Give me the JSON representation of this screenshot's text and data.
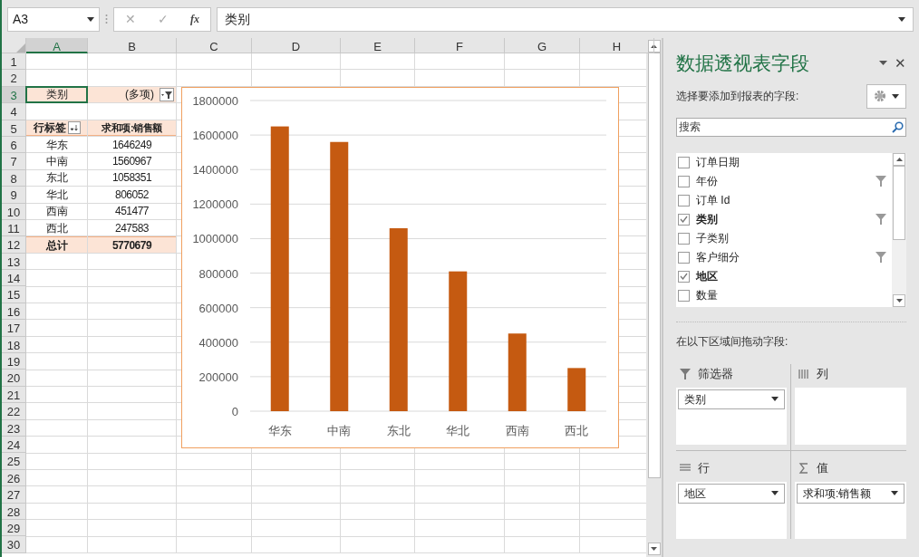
{
  "formula_bar": {
    "name_box": "A3",
    "cancel": "✕",
    "enter": "✓",
    "function": "fx",
    "value": "类别"
  },
  "sheet": {
    "columns": [
      {
        "label": "A",
        "selected": true
      },
      {
        "label": "B",
        "selected": false
      },
      {
        "label": "C",
        "selected": false
      },
      {
        "label": "D",
        "selected": false
      },
      {
        "label": "E",
        "selected": false
      },
      {
        "label": "F",
        "selected": false
      },
      {
        "label": "G",
        "selected": false
      },
      {
        "label": "H",
        "selected": false
      }
    ],
    "rows": [
      {
        "header": "1",
        "kind": "empty",
        "selected": false
      },
      {
        "header": "2",
        "kind": "empty",
        "selected": false
      },
      {
        "header": "3",
        "kind": "filter",
        "selected": true,
        "a": "类别",
        "b": "(多项)"
      },
      {
        "header": "4",
        "kind": "empty",
        "selected": false
      },
      {
        "header": "5",
        "kind": "header",
        "selected": false,
        "a": "行标签",
        "b": "求和项:销售额"
      },
      {
        "header": "6",
        "kind": "data",
        "selected": false,
        "a": "华东",
        "b": "1646249"
      },
      {
        "header": "7",
        "kind": "data",
        "selected": false,
        "a": "中南",
        "b": "1560967"
      },
      {
        "header": "8",
        "kind": "data",
        "selected": false,
        "a": "东北",
        "b": "1058351"
      },
      {
        "header": "9",
        "kind": "data",
        "selected": false,
        "a": "华北",
        "b": "806052"
      },
      {
        "header": "10",
        "kind": "data",
        "selected": false,
        "a": "西南",
        "b": "451477"
      },
      {
        "header": "11",
        "kind": "data",
        "selected": false,
        "a": "西北",
        "b": "247583"
      },
      {
        "header": "12",
        "kind": "total",
        "selected": false,
        "a": "总计",
        "b": "5770679"
      },
      {
        "header": "13",
        "kind": "empty",
        "selected": false
      },
      {
        "header": "14",
        "kind": "empty",
        "selected": false
      },
      {
        "header": "15",
        "kind": "empty",
        "selected": false
      },
      {
        "header": "16",
        "kind": "empty",
        "selected": false
      },
      {
        "header": "17",
        "kind": "empty",
        "selected": false
      },
      {
        "header": "18",
        "kind": "empty",
        "selected": false
      },
      {
        "header": "19",
        "kind": "empty",
        "selected": false
      },
      {
        "header": "20",
        "kind": "empty",
        "selected": false
      },
      {
        "header": "21",
        "kind": "empty",
        "selected": false
      },
      {
        "header": "22",
        "kind": "empty",
        "selected": false
      },
      {
        "header": "23",
        "kind": "empty",
        "selected": false
      },
      {
        "header": "24",
        "kind": "empty",
        "selected": false
      },
      {
        "header": "25",
        "kind": "empty",
        "selected": false
      },
      {
        "header": "26",
        "kind": "empty",
        "selected": false
      },
      {
        "header": "27",
        "kind": "empty",
        "selected": false
      },
      {
        "header": "28",
        "kind": "empty",
        "selected": false
      },
      {
        "header": "29",
        "kind": "empty",
        "selected": false
      },
      {
        "header": "30",
        "kind": "empty",
        "selected": false
      }
    ],
    "chart_data": {
      "type": "bar",
      "categories": [
        "华东",
        "中南",
        "东北",
        "华北",
        "西南",
        "西北"
      ],
      "series": [
        {
          "color": "#c55a11",
          "values": [
            1650000,
            1560000,
            1060000,
            810000,
            450000,
            250000
          ]
        }
      ],
      "grid": true,
      "ylim": [
        0,
        1800000
      ],
      "yticks": [
        0,
        200000,
        400000,
        600000,
        800000,
        1000000,
        1200000,
        1400000,
        1600000,
        1800000
      ]
    }
  },
  "field_pane": {
    "title": "数据透视表字段",
    "close": "✕",
    "subtitle": "选择要添加到报表的字段:",
    "search": {
      "placeholder": "搜索"
    },
    "fields": [
      {
        "label": "订单日期",
        "checked": false,
        "filtered": false
      },
      {
        "label": "年份",
        "checked": false,
        "filtered": true
      },
      {
        "label": "订单 Id",
        "checked": false,
        "filtered": false
      },
      {
        "label": "类别",
        "checked": true,
        "filtered": true
      },
      {
        "label": "子类别",
        "checked": false,
        "filtered": false
      },
      {
        "label": "客户细分",
        "checked": false,
        "filtered": true
      },
      {
        "label": "地区",
        "checked": true,
        "filtered": false
      },
      {
        "label": "数量",
        "checked": false,
        "filtered": false
      }
    ],
    "areas_caption": "在以下区域间拖动字段:",
    "areas": [
      {
        "kind": "filter",
        "label": "筛选器",
        "items": [
          "类别"
        ]
      },
      {
        "kind": "columns",
        "label": "列"
      },
      {
        "kind": "rows",
        "label": "行",
        "items": [
          "地区"
        ]
      },
      {
        "kind": "values",
        "label": "值",
        "items": [
          "求和项:销售额"
        ]
      }
    ]
  }
}
